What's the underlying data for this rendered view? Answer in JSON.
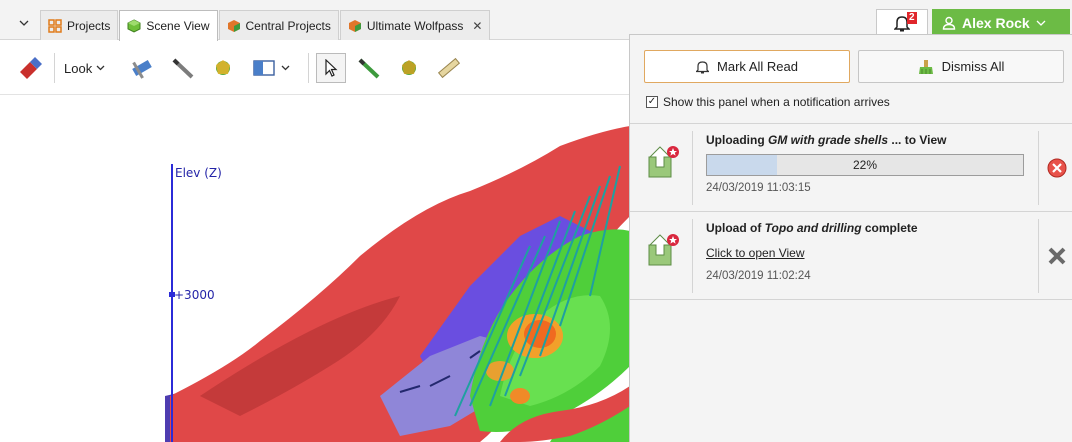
{
  "tabs": [
    {
      "label": "Projects",
      "icon": "projects-grid-icon",
      "active": false
    },
    {
      "label": "Scene View",
      "icon": "scene-cube-icon",
      "active": true
    },
    {
      "label": "Central Projects",
      "icon": "central-cube-icon",
      "active": false
    },
    {
      "label": "Ultimate Wolfpass",
      "icon": "project-cube-icon",
      "active": false,
      "closable": true
    }
  ],
  "header": {
    "notification_count": "2",
    "user_name": "Alex Rock"
  },
  "toolbar": {
    "look_label": "Look"
  },
  "scene": {
    "axis_label": "Elev (Z)",
    "tick_label": "+3000"
  },
  "panel": {
    "mark_all_read": "Mark All Read",
    "dismiss_all": "Dismiss All",
    "show_panel_label": "Show this panel when a notification arrives",
    "show_panel_checked": true,
    "notifications": [
      {
        "title_prefix": "Uploading ",
        "title_italic": "GM with grade shells",
        "title_suffix": " ... to View",
        "progress_label": "22%",
        "progress": 0.22,
        "timestamp": "24/03/2019 11:03:15",
        "action": "cancel-icon"
      },
      {
        "title_prefix": "Upload of ",
        "title_italic": "Topo and drilling",
        "title_suffix": " complete",
        "link_label": "Click to open View",
        "timestamp": "24/03/2019 11:02:24",
        "action": "dismiss-x-icon"
      }
    ]
  },
  "colors": {
    "user_green": "#6cbb45",
    "badge_red": "#e0262b",
    "axis_blue": "#2b2bd8",
    "progress_fill": "#c9d9ec"
  }
}
